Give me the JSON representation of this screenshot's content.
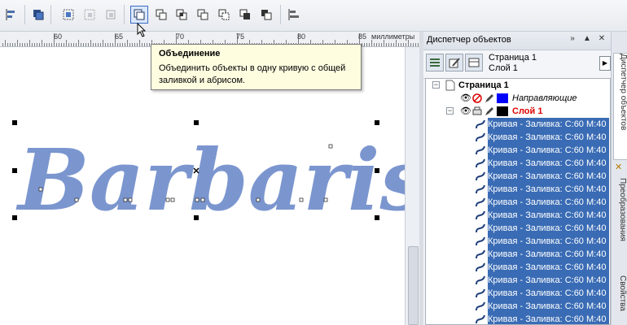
{
  "toolbar": {
    "buttons": [
      "align-icon",
      "group-icon",
      "distribute-icon",
      "ungroup-icon",
      "ungroup-all-icon",
      "weld-icon",
      "trim-icon",
      "intersect-icon",
      "simplify-icon",
      "front-minus-back-icon",
      "back-minus-front-icon",
      "create-boundary-icon",
      "align-distribute-icon"
    ],
    "active_button": "weld-icon"
  },
  "ruler": {
    "labels": [
      "60",
      "65",
      "70",
      "75",
      "80",
      "85"
    ],
    "unit": "миллиметры"
  },
  "tooltip": {
    "title": "Объединение",
    "text": "Объединить объекты в одну кривую с общей заливкой и абрисом."
  },
  "canvas": {
    "text": "Barbaris",
    "fill_color": "#7b96cf"
  },
  "docker": {
    "title": "Диспетчер объектов",
    "page": "Страница 1",
    "layer": "Слой 1",
    "tree": {
      "page_label": "Страница 1",
      "guides_label": "Направляющие",
      "layer_label": "Слой 1",
      "guides_color": "#0000ff",
      "layer_color": "#000000",
      "item_label": "Кривая - Заливка: C:60 M:40",
      "items": [
        "Кривая - Заливка: C:60 M:40",
        "Кривая - Заливка: C:60 M:40",
        "Кривая - Заливка: C:60 M:40",
        "Кривая - Заливка: C:60 M:40",
        "Кривая - Заливка: C:60 M:40",
        "Кривая - Заливка: C:60 M:40",
        "Кривая - Заливка: C:60 M:40",
        "Кривая - Заливка: C:60 M:40",
        "Кривая - Заливка: C:60 M:40",
        "Кривая - Заливка: C:60 M:40",
        "Кривая - Заливка: C:60 M:40",
        "Кривая - Заливка: C:60 M:40",
        "Кривая - Заливка: C:60 M:40",
        "Кривая - Заливка: C:60 M:40",
        "Кривая - Заливка: C:60 M:40",
        "Кривая - Заливка: C:60 M:40"
      ]
    }
  },
  "side_tabs": [
    "Диспетчер объектов",
    "Преобразования",
    "Свойства"
  ],
  "colors": {
    "selection": "#3a6cb5",
    "accent": "#3b6cc4",
    "layer_text": "#e00000"
  }
}
